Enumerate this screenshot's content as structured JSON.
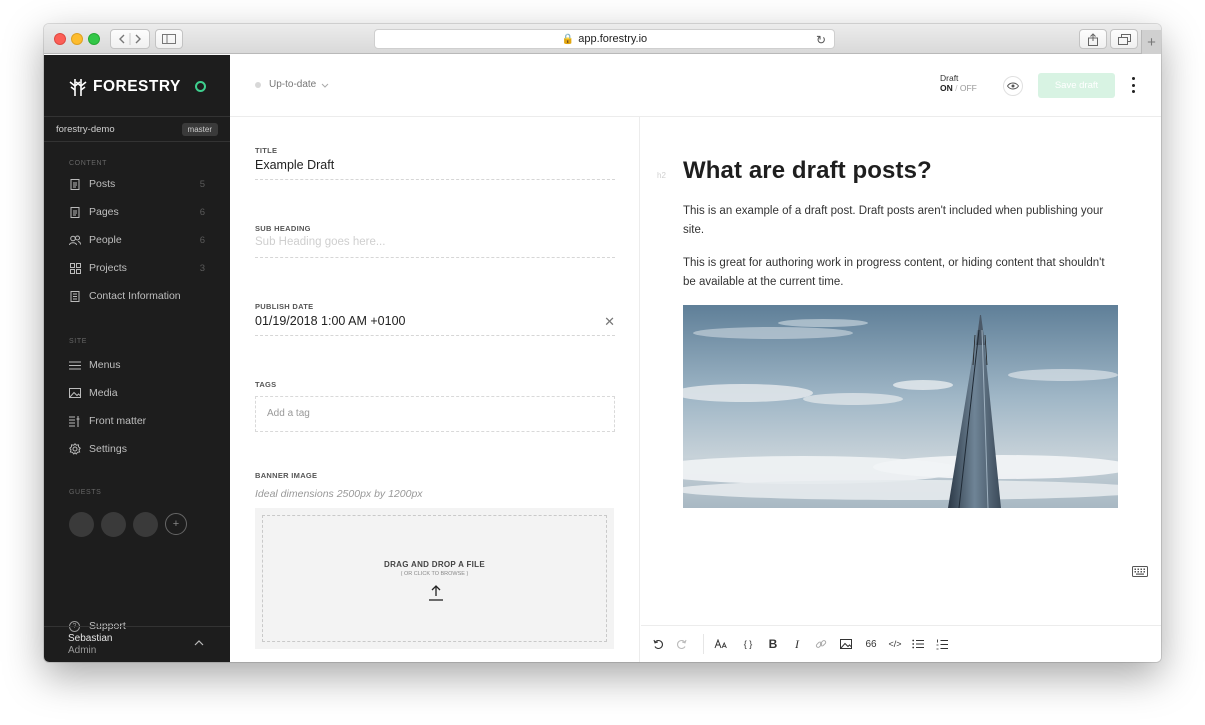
{
  "browser": {
    "url": "app.forestry.io"
  },
  "sidebar": {
    "brand": "FORESTRY",
    "site_name": "forestry-demo",
    "branch": "master",
    "content_label": "CONTENT",
    "site_label": "SITE",
    "guests_label": "GUESTS",
    "content_items": [
      {
        "label": "Posts",
        "count": "5",
        "icon": "document-icon"
      },
      {
        "label": "Pages",
        "count": "6",
        "icon": "document-icon"
      },
      {
        "label": "People",
        "count": "6",
        "icon": "people-icon"
      },
      {
        "label": "Projects",
        "count": "3",
        "icon": "grid-icon"
      },
      {
        "label": "Contact Information",
        "count": "",
        "icon": "file-icon"
      }
    ],
    "site_items": [
      {
        "label": "Menus",
        "icon": "menu-icon"
      },
      {
        "label": "Media",
        "icon": "image-icon"
      },
      {
        "label": "Front matter",
        "icon": "front-matter-icon"
      },
      {
        "label": "Settings",
        "icon": "gear-icon"
      }
    ],
    "support_label": "Support",
    "user": {
      "name": "Sebastian",
      "role": "Admin"
    }
  },
  "header": {
    "status": "Up-to-date",
    "draft_label": "Draft",
    "draft_on": "ON",
    "draft_sep": "/",
    "draft_off": "OFF",
    "save_label": "Save draft"
  },
  "form": {
    "title_label": "TITLE",
    "title_value": "Example Draft",
    "subheading_label": "SUB HEADING",
    "subheading_placeholder": "Sub Heading goes here...",
    "publish_label": "PUBLISH DATE",
    "publish_value": "01/19/2018 1:00 AM +0100",
    "tags_label": "TAGS",
    "tags_placeholder": "Add a tag",
    "banner_label": "BANNER IMAGE",
    "banner_hint": "Ideal dimensions 2500px by 1200px",
    "dropzone_title": "DRAG AND DROP A FILE",
    "dropzone_sub": "( OR CLICK TO BROWSE )"
  },
  "preview": {
    "heading_tag": "h2",
    "heading": "What are draft posts?",
    "paragraph1": "This is an example of a draft post. Draft posts aren't included when publishing your site.",
    "paragraph2": "This is great for authoring work in progress content, or hiding content that shouldn't be available at the current time."
  },
  "toolbar": {
    "code_label": "{ }",
    "bold_label": "B",
    "italic_label": "I",
    "quote_label": "66",
    "html_label": "</>"
  },
  "colors": {
    "sidebar_bg": "#1d1d1d",
    "accent": "#3ecf8e",
    "save_button": "#d8f3e3"
  }
}
